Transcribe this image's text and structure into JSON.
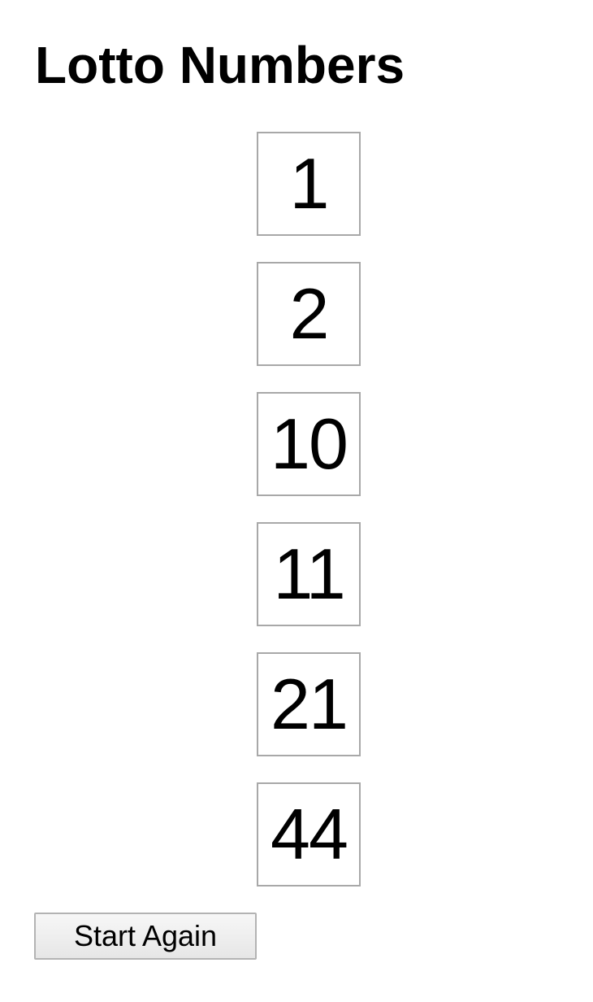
{
  "page": {
    "title": "Lotto Numbers"
  },
  "numbers": [
    "1",
    "2",
    "10",
    "11",
    "21",
    "44"
  ],
  "actions": {
    "start_again_label": "Start Again"
  }
}
